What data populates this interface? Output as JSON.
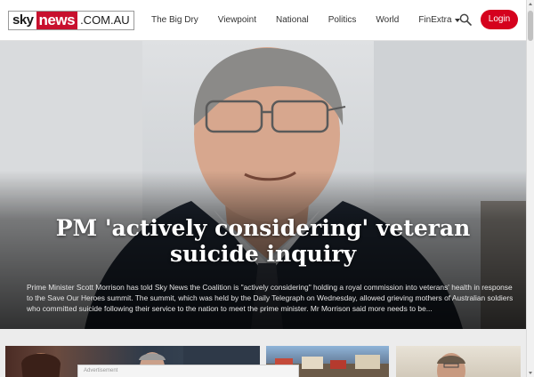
{
  "header": {
    "logo": {
      "sky": "sky",
      "news": "news",
      "domain": ".COM.AU"
    },
    "nav": [
      {
        "label": "The Big Dry"
      },
      {
        "label": "Viewpoint"
      },
      {
        "label": "National"
      },
      {
        "label": "Politics"
      },
      {
        "label": "World"
      },
      {
        "label": "FinExtra",
        "has_dropdown": true
      }
    ],
    "search_icon": "search-icon",
    "login_label": "Login"
  },
  "hero": {
    "headline": "PM 'actively considering' veteran suicide inquiry",
    "summary": "Prime Minister Scott Morrison has told Sky News the Coalition is \"actively considering\" holding a royal commission into veterans' health in response to the Save Our Heroes summit. The summit, which was held by the Daily Telegraph on Wednesday, allowed grieving mothers of Australian soldiers who committed suicide following their service to the nation to meet the prime minister. Mr Morrison said more needs to be..."
  },
  "ad_bar": {
    "label": "Advertisement"
  },
  "colors": {
    "brand_red": "#c8102e",
    "login_red": "#d5011d",
    "header_bg": "#ffffff",
    "page_bg": "#ececec"
  }
}
